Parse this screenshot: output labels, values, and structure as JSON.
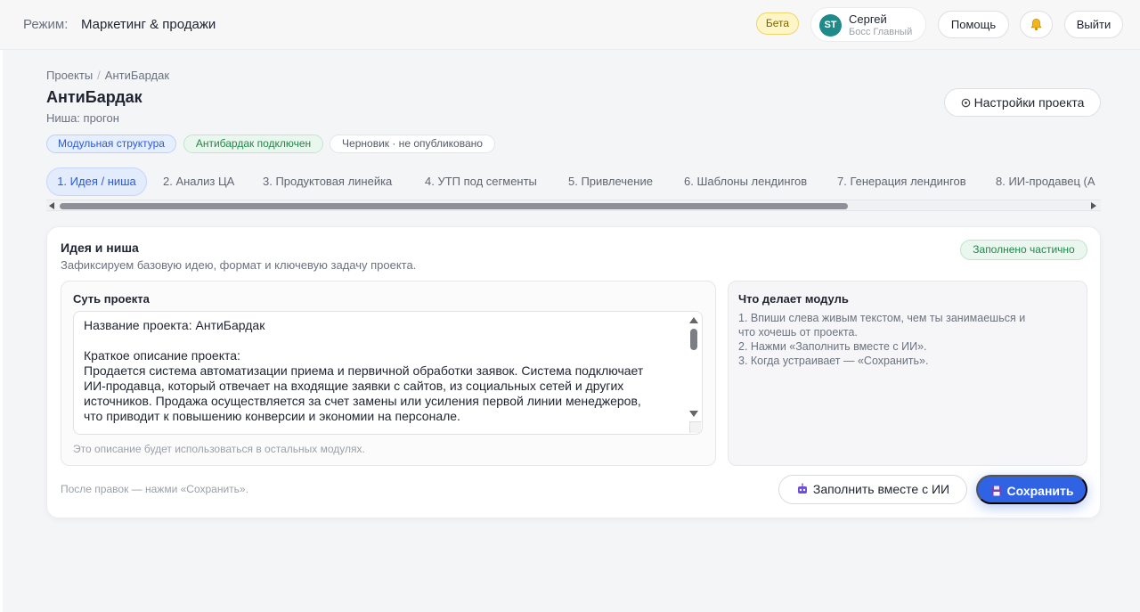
{
  "header": {
    "mode_label": "Режим:",
    "mode_value": "Маркетинг & продажи",
    "beta_label": "Бета",
    "user": {
      "initials": "ST",
      "name": "Сергей",
      "role": "Босс Главный"
    },
    "help_label": "Помощь",
    "exit_label": "Выйти"
  },
  "project": {
    "breadcrumb": [
      "Проекты",
      "АнтиБардак"
    ],
    "title": "АнтиБардак",
    "niche": "Ниша: прогон",
    "settings_label": "Настройки проекта",
    "badges": [
      "Модульная структура",
      "Антибардак подключен",
      "Черновик · не опубликовано"
    ]
  },
  "tabs": [
    "1. Идея / ниша",
    "2. Анализ ЦА",
    "3. Продуктовая линейка",
    "4. УТП под сегменты",
    "5. Привлечение",
    "6. Шаблоны лендингов",
    "7. Генерация лендингов",
    "8. ИИ-продавец (А"
  ],
  "card": {
    "title": "Идея и ниша",
    "subtitle": "Зафиксируем базовую идею, формат и ключевую задачу проекта.",
    "status": "Заполнено частично",
    "essence_label": "Суть проекта",
    "essence_lines": [
      "Название проекта: АнтиБардак",
      "",
      "Краткое описание проекта:",
      "Продается система автоматизации приема и первичной обработки заявок. Система подключает",
      "ИИ-продавца, который отвечает на входящие заявки с сайтов, из социальных сетей и других",
      "источников. Продажа осуществляется за счет замены или усиления первой линии менеджеров,",
      "что приводит к повышению конверсии и экономии на персонале."
    ],
    "essence_hint": "Это описание будет использоваться в остальных модулях.",
    "module_label": "Что делает модуль",
    "module_steps": [
      "1. Впиши слева живым текстом, чем ты занимаешься и",
      "что хочешь от проекта.",
      "2. Нажми «Заполнить вместе с ИИ».",
      "3. Когда устраивает — «Сохранить»."
    ],
    "footer_hint": "После правок — нажми «Сохранить».",
    "ai_button": "Заполнить вместе с ИИ",
    "save_button": "Сохранить"
  },
  "colors": {
    "accent": "#2f63e3",
    "success": "#22874a",
    "beta": "#fff5c6"
  },
  "icons": [
    "bell-icon",
    "gear-icon",
    "robot-icon",
    "floppy-icon"
  ]
}
